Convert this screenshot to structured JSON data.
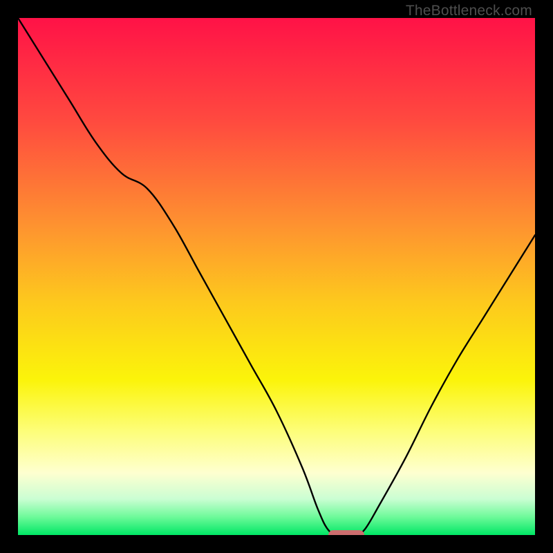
{
  "watermark": {
    "text": "TheBottleneck.com"
  },
  "chart_data": {
    "type": "line",
    "title": "",
    "xlabel": "",
    "ylabel": "",
    "xlim": [
      0,
      100
    ],
    "ylim": [
      0,
      100
    ],
    "grid": false,
    "legend": false,
    "background": {
      "type": "vertical-gradient",
      "stops": [
        {
          "pos": 0.0,
          "color": "#ff1247"
        },
        {
          "pos": 0.2,
          "color": "#ff4a3f"
        },
        {
          "pos": 0.4,
          "color": "#fe9230"
        },
        {
          "pos": 0.55,
          "color": "#fdc91d"
        },
        {
          "pos": 0.7,
          "color": "#fbf40a"
        },
        {
          "pos": 0.8,
          "color": "#fdfe7a"
        },
        {
          "pos": 0.88,
          "color": "#feffd0"
        },
        {
          "pos": 0.93,
          "color": "#cbfed3"
        },
        {
          "pos": 0.965,
          "color": "#6efa9a"
        },
        {
          "pos": 1.0,
          "color": "#00e765"
        }
      ]
    },
    "series": [
      {
        "name": "bottleneck-curve",
        "color": "#000000",
        "x": [
          0.0,
          5,
          10,
          15,
          20,
          25,
          30,
          35,
          40,
          45,
          50,
          55,
          58,
          60,
          62,
          65,
          67,
          70,
          75,
          80,
          85,
          90,
          95,
          100
        ],
        "y": [
          100,
          92,
          84,
          76,
          70,
          67,
          60,
          51,
          42,
          33,
          24,
          13,
          5,
          1,
          0,
          0,
          1,
          6,
          15,
          25,
          34,
          42,
          50,
          58
        ]
      }
    ],
    "marker": {
      "name": "optimal-range",
      "color": "#cc6d6e",
      "x_start": 60,
      "x_end": 67,
      "y": 0
    }
  }
}
